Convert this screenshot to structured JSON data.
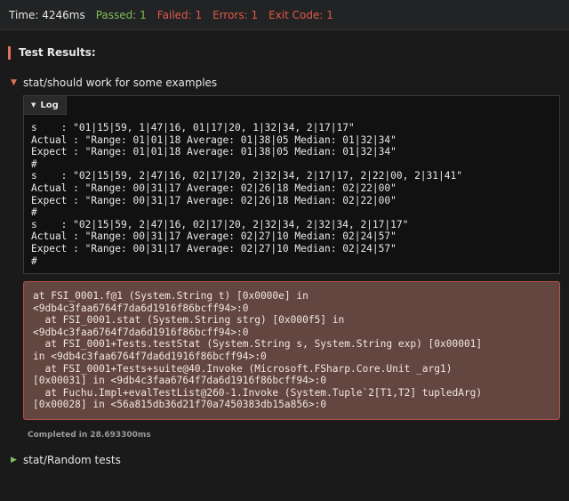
{
  "status": {
    "time": "Time: 4246ms",
    "passed": "Passed: 1",
    "failed": "Failed: 1",
    "errors": "Errors: 1",
    "exit_code": "Exit Code: 1"
  },
  "results_header": "Test Results:",
  "suite1": {
    "label": "stat/should work for some examples",
    "log_tab": "Log",
    "log_lines": [
      "s    : \"01|15|59, 1|47|16, 01|17|20, 1|32|34, 2|17|17\"",
      "Actual : \"Range: 01|01|18 Average: 01|38|05 Median: 01|32|34\"",
      "Expect : \"Range: 01|01|18 Average: 01|38|05 Median: 01|32|34\"",
      "#",
      "s    : \"02|15|59, 2|47|16, 02|17|20, 2|32|34, 2|17|17, 2|22|00, 2|31|41\"",
      "Actual : \"Range: 00|31|17 Average: 02|26|18 Median: 02|22|00\"",
      "Expect : \"Range: 00|31|17 Average: 02|26|18 Median: 02|22|00\"",
      "#",
      "s    : \"02|15|59, 2|47|16, 02|17|20, 2|32|34, 2|32|34, 2|17|17\"",
      "Actual : \"Range: 00|31|17 Average: 02|27|10 Median: 02|24|57\"",
      "Expect : \"Range: 00|31|17 Average: 02|27|10 Median: 02|24|57\"",
      "#"
    ],
    "error_lines": [
      "at FSI_0001.f@1 (System.String t) [0x0000e] in",
      "<9db4c3faa6764f7da6d1916f86bcff94>:0",
      "  at FSI_0001.stat (System.String strg) [0x000f5] in",
      "<9db4c3faa6764f7da6d1916f86bcff94>:0",
      "  at FSI_0001+Tests.testStat (System.String s, System.String exp) [0x00001]",
      "in <9db4c3faa6764f7da6d1916f86bcff94>:0",
      "  at FSI_0001+Tests+suite@40.Invoke (Microsoft.FSharp.Core.Unit _arg1)",
      "[0x00031] in <9db4c3faa6764f7da6d1916f86bcff94>:0",
      "  at Fuchu.Impl+evalTestList@260-1.Invoke (System.Tuple`2[T1,T2] tupledArg)",
      "[0x00028] in <56a815db36d21f70a7450383db15a856>:0"
    ],
    "completed": "Completed in 28.693300ms"
  },
  "suite2": {
    "label": "stat/Random tests"
  },
  "colors": {
    "failed_accent": "#e05a4a",
    "passed_accent": "#7fbf5a",
    "error_bg": "#63463f"
  },
  "icons": {
    "suite1_toggle": "caret-down-icon",
    "suite2_toggle": "caret-right-icon",
    "log_toggle": "caret-down-icon"
  }
}
